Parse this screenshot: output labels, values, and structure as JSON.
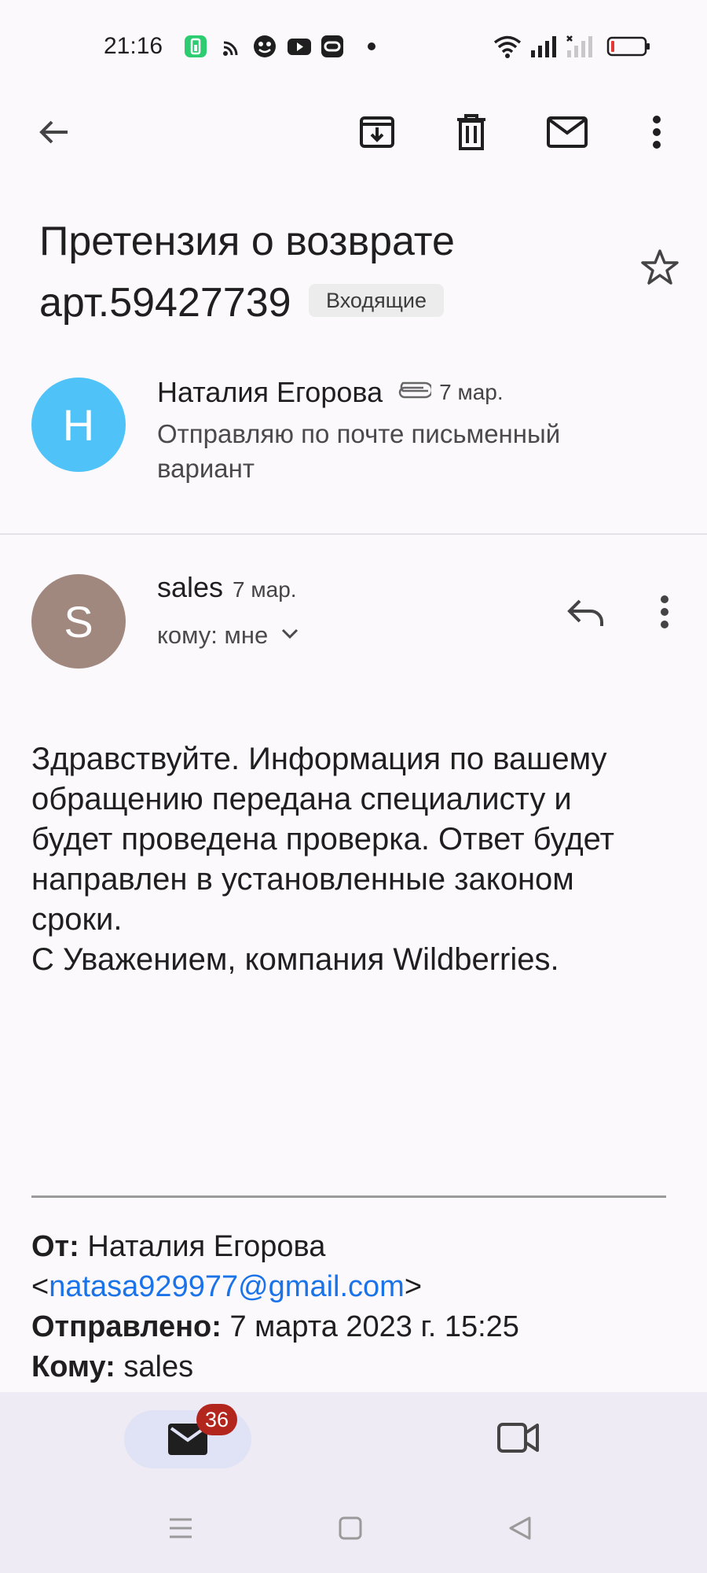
{
  "status_bar": {
    "time": "21:16",
    "icons": [
      "battery-saver-icon",
      "cast-icon",
      "face-app-icon",
      "youtube-icon",
      "vr-app-icon",
      "notification-dot-icon",
      "wifi-icon",
      "signal-icon",
      "signal-no-service-icon",
      "battery-low-icon"
    ],
    "battery_color": "#e53935"
  },
  "toolbar": {
    "icons": [
      "back-arrow-icon",
      "archive-icon",
      "delete-icon",
      "mark-unread-icon",
      "more-vert-icon"
    ]
  },
  "email": {
    "subject": "Претензия о возврате арт.59427739",
    "label": "Входящие"
  },
  "thread": {
    "collapsed_message": {
      "avatar_letter": "Н",
      "avatar_color": "#4fc3f7",
      "sender": "Наталия Егорова",
      "date": "7 мар.",
      "snippet": "Отправляю по почте письменный вариант"
    },
    "expanded_message": {
      "avatar_letter": "S",
      "avatar_color": "#a1887f",
      "sender": "sales",
      "date": "7 мар.",
      "recipient": "кому: мне",
      "body": [
        "Здравствуйте. Информация по вашему",
        "обращению передана специалисту и",
        "будет проведена проверка. Ответ будет",
        "направлен в установленные законом",
        "сроки.",
        "С Уважением, компания Wildberries."
      ],
      "quote": {
        "from_label": "От:",
        "from_name": "Наталия Егорова",
        "from_email": "natasa929977@gmail.com",
        "sent_label": "Отправлено:",
        "sent_value": "7 марта 2023 г. 15:25",
        "to_label": "Кому:",
        "to_value": "sales"
      }
    }
  },
  "bottom_nav": {
    "mail_badge": "36",
    "accent": "#b3261e"
  }
}
